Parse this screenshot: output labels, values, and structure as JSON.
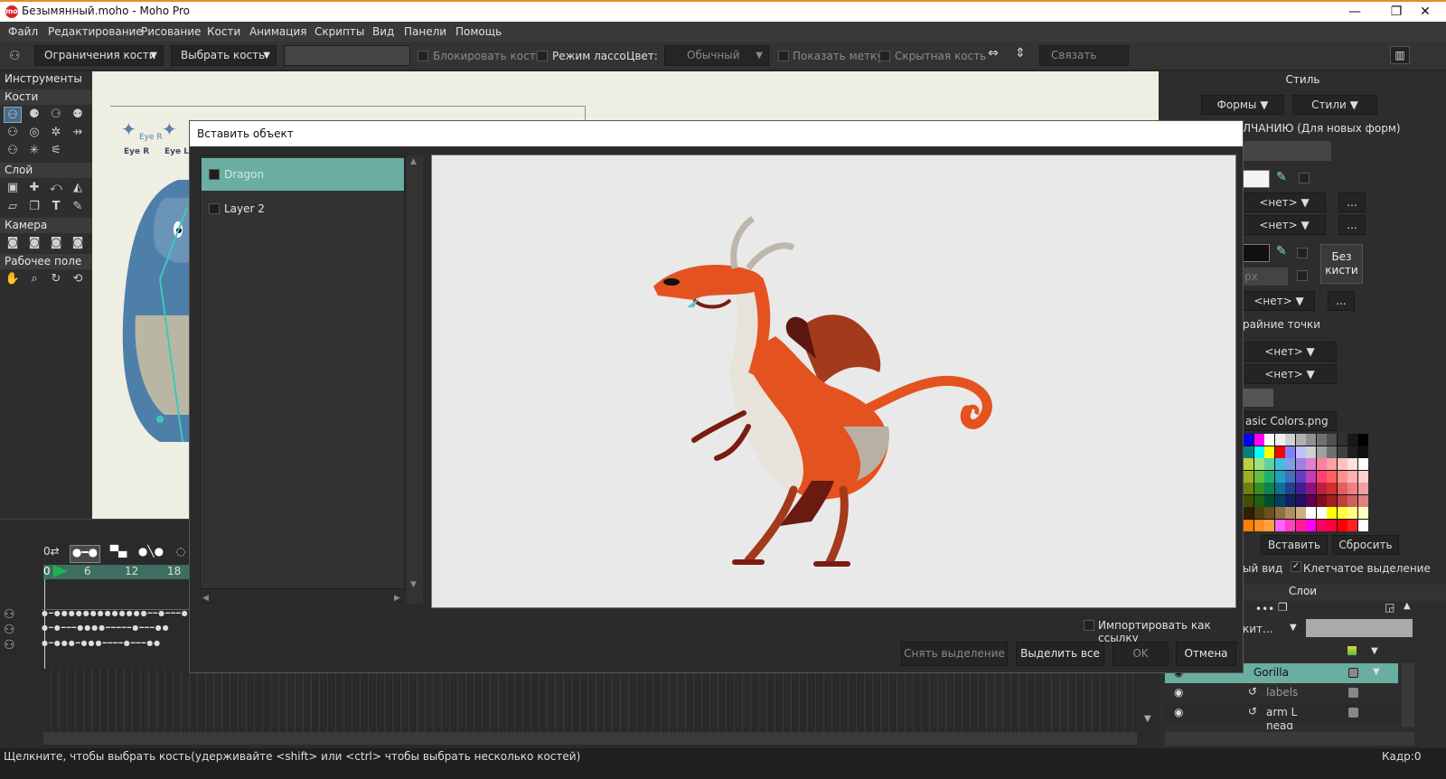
{
  "window": {
    "title": "Безымянный.moho - Moho Pro",
    "logo": "mo",
    "controls": [
      "—",
      "❐",
      "✕"
    ]
  },
  "menu": [
    "Файл",
    "Редактирование",
    "Рисование",
    "Кости",
    "Анимация",
    "Скрипты",
    "Вид",
    "Панели",
    "Помощь"
  ],
  "toolbar": {
    "bone_constraints": "Ограничения кости",
    "select_bone": "Выбрать кость",
    "lock_bone": "Блокировать кость",
    "lasso_mode": "Режим лассо",
    "color_label": "Цвет:",
    "color_value": "Обычный",
    "show_label": "Показать метку",
    "hidden_bone": "Скрытная кость",
    "bind_bones": "Связать кости"
  },
  "tools": {
    "header": "Инструменты",
    "sections": [
      "Кости",
      "Слой",
      "Камера",
      "Рабочее поле"
    ]
  },
  "canvas": {
    "eye_r": "Eye R",
    "eye_l": "Eye L"
  },
  "timeline": {
    "frame_zero": "0",
    "ticks": [
      "0",
      "6",
      "12",
      "18"
    ]
  },
  "right_panel": {
    "style_title": "Стиль",
    "shapes": "Формы",
    "styles": "Стили",
    "default_text": "ЛЧАНИЮ (Для новых форм)",
    "none1": "<нет>",
    "none2": "<нет>",
    "no_brush": "Без кисти",
    "none3": "<нет>",
    "endpoints": "райние точки",
    "none4": "<нет>",
    "none5": "<нет>",
    "palette": "asic Colors.png",
    "paste": "Вставить",
    "reset": "Сбросить",
    "view": "ый вид",
    "checker_select": "Клетчатое выделение",
    "layers_title": "Слои",
    "layer_mode": "кит...",
    "layers": [
      "Gorilla",
      "labels",
      "arm L",
      "head"
    ]
  },
  "status": {
    "hint": "Щелкните, чтобы выбрать кость(удерживайте <shift> или <ctrl> чтобы выбрать несколько костей)",
    "frame": "Кадр:0"
  },
  "dialog": {
    "title": "Вставить объект",
    "layers": [
      "Dragon",
      "Layer 2"
    ],
    "import_as_link": "Импортировать как ссылку",
    "deselect": "Снять выделение",
    "select_all": "Выделить все",
    "ok": "OK",
    "cancel": "Отмена"
  },
  "colors": {
    "accent_teal": "#6aaea1",
    "dragon_orange": "#e4521f",
    "dragon_dark": "#7a1d10"
  }
}
